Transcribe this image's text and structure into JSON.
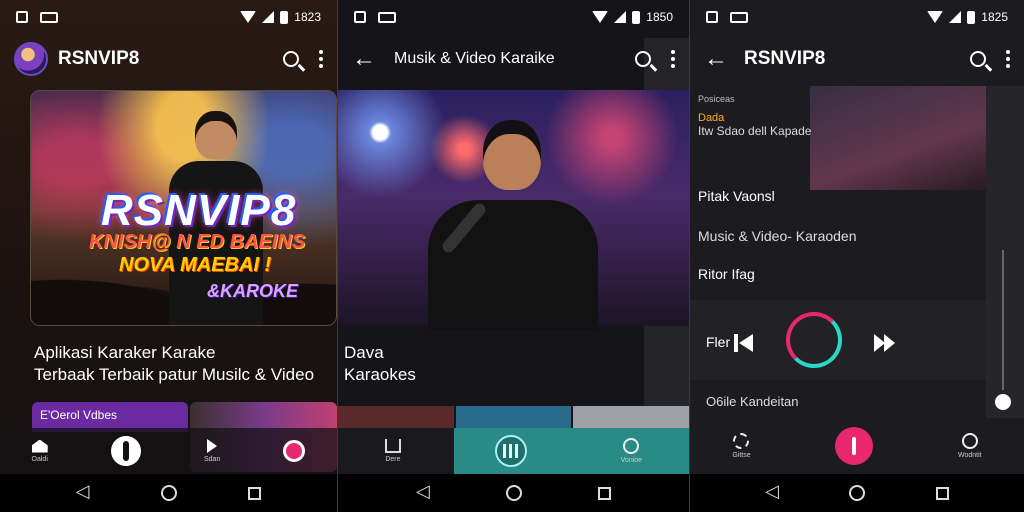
{
  "status_bars": [
    {
      "time": "1823"
    },
    {
      "time": "1850"
    },
    {
      "time": "1825"
    }
  ],
  "screen1": {
    "app_title": "RSNVIP8",
    "hero": {
      "logo": "RSNVIP8",
      "line1": "KNISH@ N ED BAEINS",
      "line2": "NOVA MAEBAI !",
      "line3": "&KAROKE"
    },
    "caption": [
      "Aplikasi Karaker Karake",
      "Terbaak Terbaik patur Musilc & Video"
    ],
    "chip_label": "E'Oerol Vdbes",
    "nav": [
      "Oaldi",
      "",
      "Sdan",
      ""
    ]
  },
  "screen2": {
    "title": "Musik & Video Karaike",
    "caption": [
      "Dava",
      "Karaokes"
    ],
    "nav": [
      "Dere",
      "",
      "Vonioe"
    ]
  },
  "screen3": {
    "title": "RSNVIP8",
    "list": [
      {
        "line1": "Posiceas",
        "line2": "Dada",
        "line3": "Itw Sdao dell Kapade"
      },
      {
        "line1": "Pitak Vaonsl"
      },
      {
        "line1": "Music & Video- Karaoden"
      },
      {
        "line1": "Ritor Ifag"
      }
    ],
    "player_label": "Fler",
    "footer_text": "O6ile Kandeitan",
    "nav": [
      "Gittse",
      "",
      "Wodntit"
    ]
  }
}
